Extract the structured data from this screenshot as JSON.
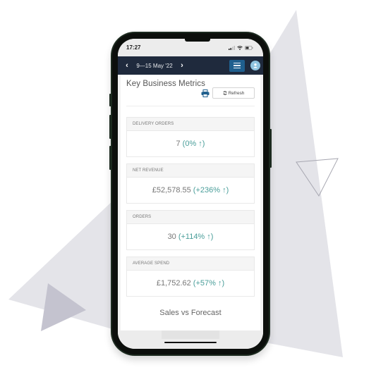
{
  "status_bar": {
    "time": "17:27",
    "icons": [
      "signal-icon",
      "wifi-icon",
      "battery-icon"
    ]
  },
  "nav_bar": {
    "prev_label": "‹",
    "date_range": "9—15 May '22",
    "next_label": "›",
    "menu_icon": "hamburger-menu-icon",
    "avatar_icon": "user-avatar-icon",
    "colors": {
      "background": "#1f2a3d",
      "menu_button": "#1f5f8e",
      "avatar": "#8fc3df"
    }
  },
  "page": {
    "title": "Key Business Metrics",
    "print_icon": "print-icon",
    "refresh_label": "Refresh",
    "refresh_icon": "refresh-icon"
  },
  "metrics": [
    {
      "label": "DELIVERY ORDERS",
      "value": "7",
      "change": "(0% ↑)"
    },
    {
      "label": "NET REVENUE",
      "value": "£52,578.55",
      "change": "(+236% ↑)"
    },
    {
      "label": "ORDERS",
      "value": "30",
      "change": "(+114% ↑)"
    },
    {
      "label": "AVERAGE SPEND",
      "value": "£1,752.62",
      "change": "(+57% ↑)"
    }
  ],
  "sections": {
    "sales_vs_forecast_title": "Sales vs Forecast"
  },
  "colors": {
    "positive_change": "#4a9e9a",
    "print_icon": "#1f5f8e",
    "background_shape": "#e3e3e8",
    "background_shape_dark": "#c4c3cf"
  }
}
